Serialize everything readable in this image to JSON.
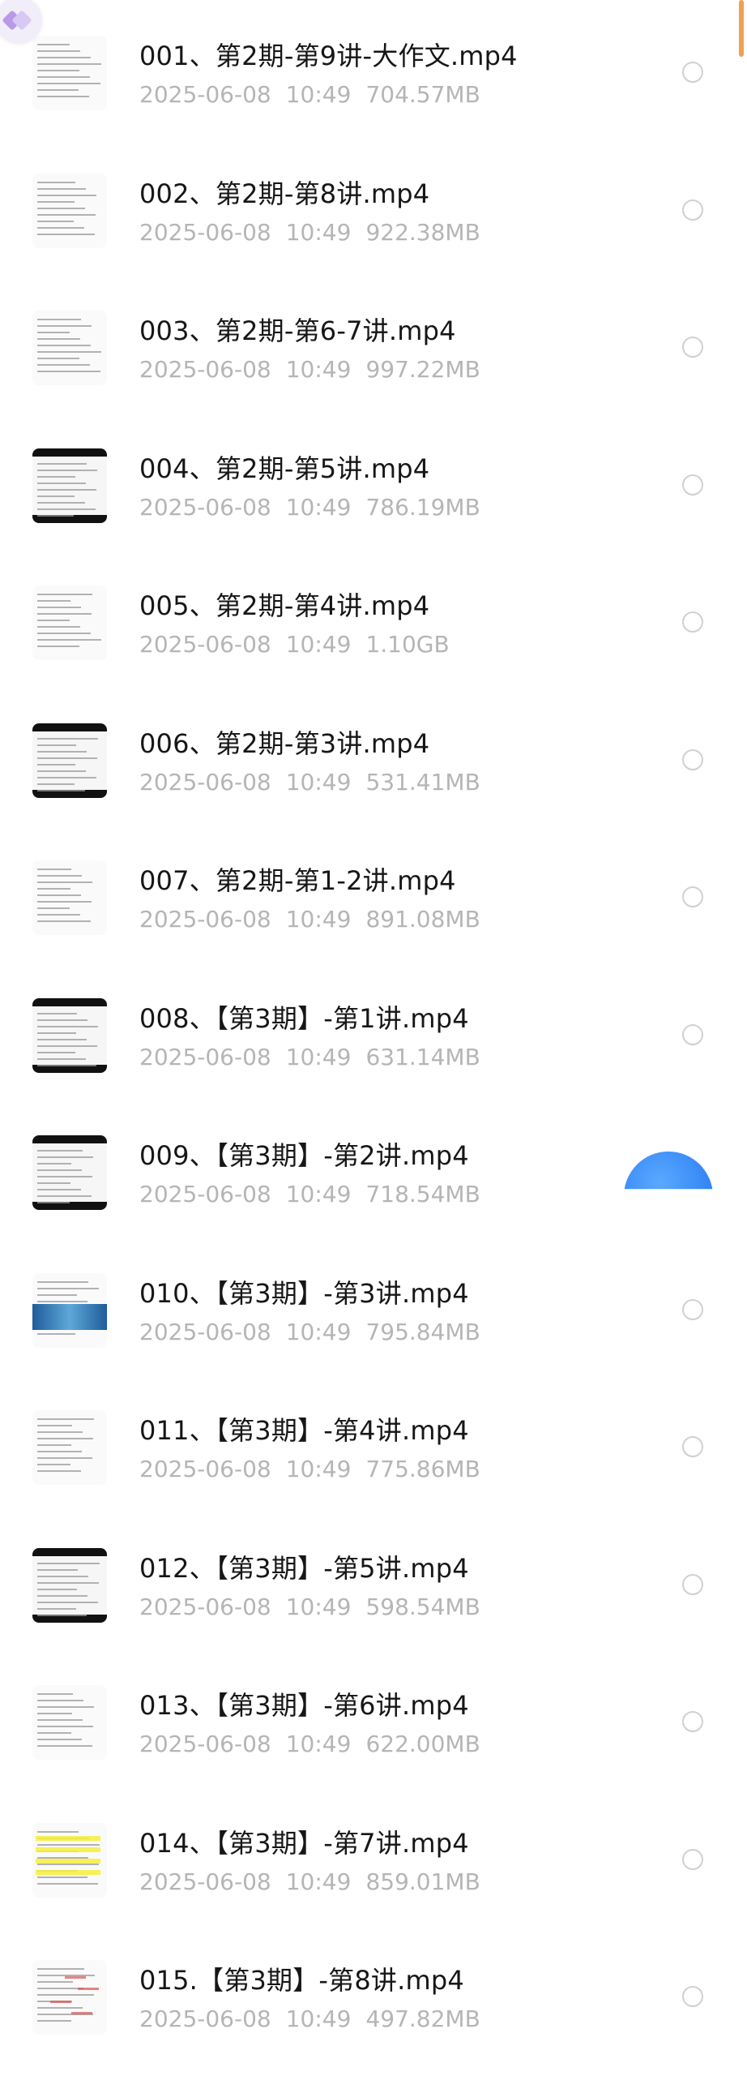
{
  "files": [
    {
      "name": "001、第2期-第9讲-大作文.mp4",
      "date": "2025-06-08",
      "time": "10:49",
      "size": "704.57MB"
    },
    {
      "name": "002、第2期-第8讲.mp4",
      "date": "2025-06-08",
      "time": "10:49",
      "size": "922.38MB"
    },
    {
      "name": "003、第2期-第6-7讲.mp4",
      "date": "2025-06-08",
      "time": "10:49",
      "size": "997.22MB"
    },
    {
      "name": "004、第2期-第5讲.mp4",
      "date": "2025-06-08",
      "time": "10:49",
      "size": "786.19MB"
    },
    {
      "name": "005、第2期-第4讲.mp4",
      "date": "2025-06-08",
      "time": "10:49",
      "size": "1.10GB"
    },
    {
      "name": "006、第2期-第3讲.mp4",
      "date": "2025-06-08",
      "time": "10:49",
      "size": "531.41MB"
    },
    {
      "name": "007、第2期-第1-2讲.mp4",
      "date": "2025-06-08",
      "time": "10:49",
      "size": "891.08MB"
    },
    {
      "name": "008、【第3期】-第1讲.mp4",
      "date": "2025-06-08",
      "time": "10:49",
      "size": "631.14MB"
    },
    {
      "name": "009、【第3期】-第2讲.mp4",
      "date": "2025-06-08",
      "time": "10:49",
      "size": "718.54MB"
    },
    {
      "name": "010、【第3期】-第3讲.mp4",
      "date": "2025-06-08",
      "time": "10:49",
      "size": "795.84MB"
    },
    {
      "name": "011、【第3期】-第4讲.mp4",
      "date": "2025-06-08",
      "time": "10:49",
      "size": "775.86MB"
    },
    {
      "name": "012、【第3期】-第5讲.mp4",
      "date": "2025-06-08",
      "time": "10:49",
      "size": "598.54MB"
    },
    {
      "name": "013、【第3期】-第6讲.mp4",
      "date": "2025-06-08",
      "time": "10:49",
      "size": "622.00MB"
    },
    {
      "name": "014、【第3期】-第7讲.mp4",
      "date": "2025-06-08",
      "time": "10:49",
      "size": "859.01MB"
    },
    {
      "name": "015.【第3期】-第8讲.mp4",
      "date": "2025-06-08",
      "time": "10:49",
      "size": "497.82MB"
    }
  ],
  "colors": {
    "title": "#161616",
    "meta": "#b5b5b5",
    "radio_border": "#d0d0d0",
    "fab": "#1f72f0",
    "scroll_thumb": "#f0a050"
  },
  "icons": {
    "app_badge": "app-badge-icon",
    "selection": "radio-circle-icon",
    "floating_button": "floating-action-button"
  }
}
